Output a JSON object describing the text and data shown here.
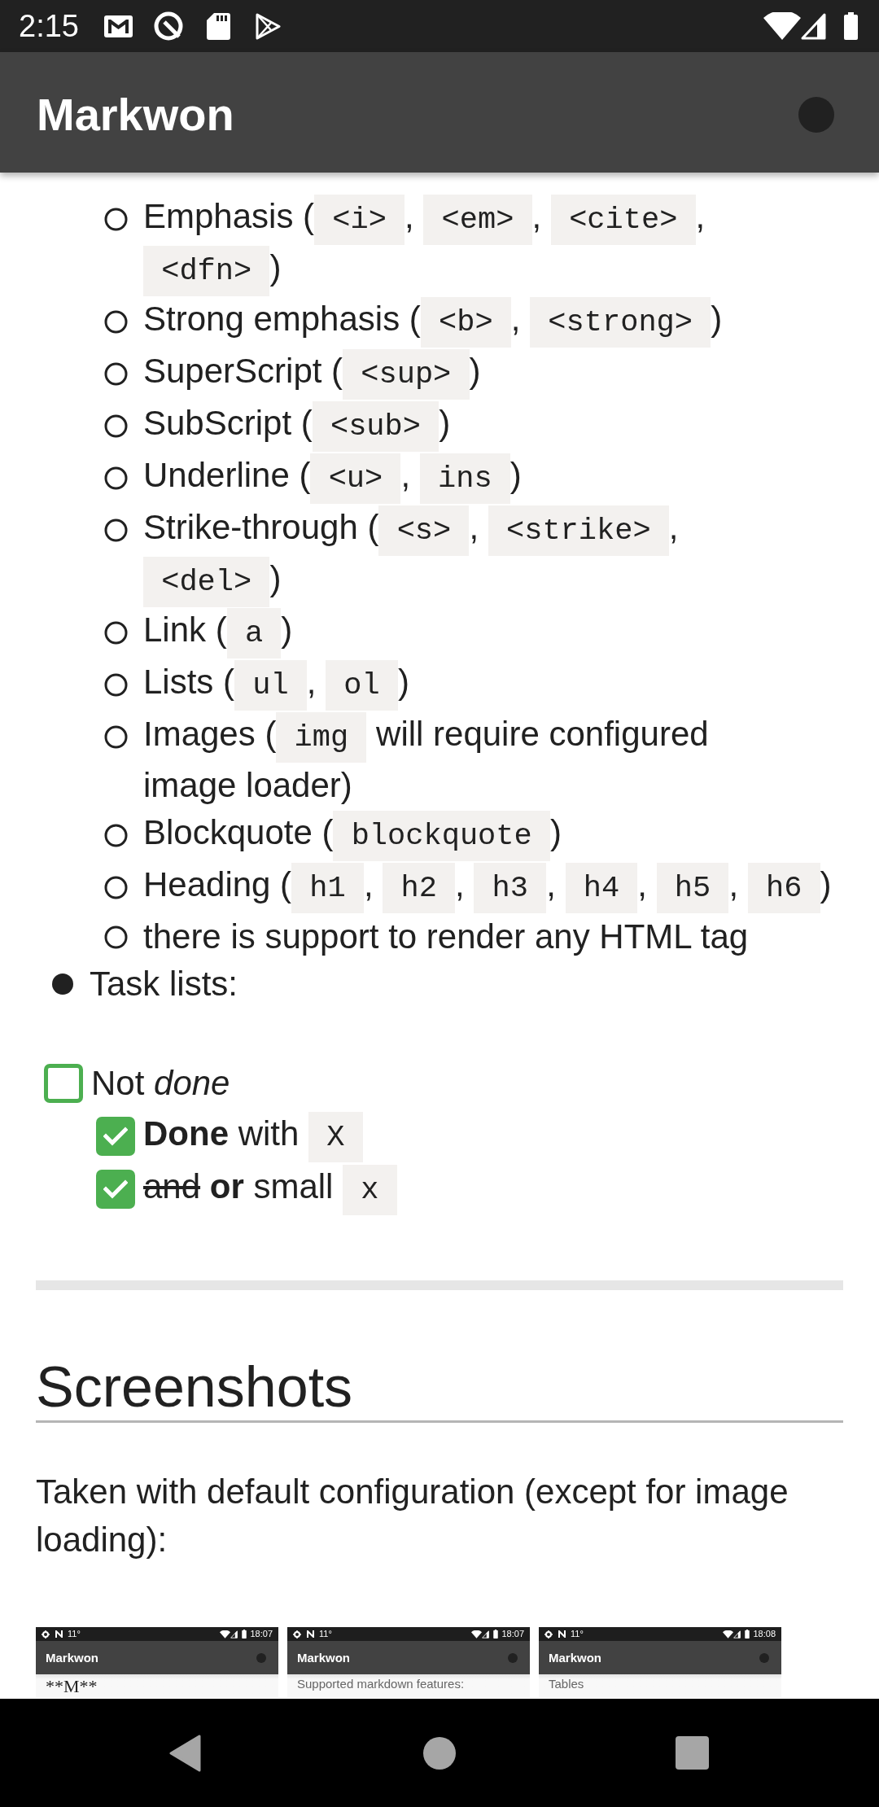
{
  "status_bar": {
    "time": "2:15"
  },
  "app_bar": {
    "title": "Markwon"
  },
  "list": [
    {
      "children": [
        {
          "lines": [
            [
              {
                "kind": "text",
                "text": "Emphasis ("
              },
              {
                "kind": "code",
                "text": "<i>"
              },
              {
                "kind": "text",
                "text": ", "
              },
              {
                "kind": "code",
                "text": "<em>"
              },
              {
                "kind": "text",
                "text": ", "
              },
              {
                "kind": "code",
                "text": "<cite>"
              },
              {
                "kind": "text",
                "text": ","
              }
            ],
            [
              {
                "kind": "code",
                "text": "<dfn>"
              },
              {
                "kind": "text",
                "text": ")"
              }
            ]
          ]
        },
        {
          "lines": [
            [
              {
                "kind": "text",
                "text": "Strong emphasis ("
              },
              {
                "kind": "code",
                "text": "<b>"
              },
              {
                "kind": "text",
                "text": ", "
              },
              {
                "kind": "code",
                "text": "<strong>"
              },
              {
                "kind": "text",
                "text": ")"
              }
            ]
          ]
        },
        {
          "lines": [
            [
              {
                "kind": "text",
                "text": "SuperScript ("
              },
              {
                "kind": "code",
                "text": "<sup>"
              },
              {
                "kind": "text",
                "text": ")"
              }
            ]
          ]
        },
        {
          "lines": [
            [
              {
                "kind": "text",
                "text": "SubScript ("
              },
              {
                "kind": "code",
                "text": "<sub>"
              },
              {
                "kind": "text",
                "text": ")"
              }
            ]
          ]
        },
        {
          "lines": [
            [
              {
                "kind": "text",
                "text": "Underline ("
              },
              {
                "kind": "code",
                "text": "<u>"
              },
              {
                "kind": "text",
                "text": ", "
              },
              {
                "kind": "code",
                "text": "ins"
              },
              {
                "kind": "text",
                "text": ")"
              }
            ]
          ]
        },
        {
          "lines": [
            [
              {
                "kind": "text",
                "text": "Strike-through ("
              },
              {
                "kind": "code",
                "text": "<s>"
              },
              {
                "kind": "text",
                "text": ", "
              },
              {
                "kind": "code",
                "text": "<strike>"
              },
              {
                "kind": "text",
                "text": ","
              }
            ],
            [
              {
                "kind": "code",
                "text": "<del>"
              },
              {
                "kind": "text",
                "text": ")"
              }
            ]
          ]
        },
        {
          "lines": [
            [
              {
                "kind": "text",
                "text": "Link ("
              },
              {
                "kind": "code",
                "text": "a"
              },
              {
                "kind": "text",
                "text": ")"
              }
            ]
          ]
        },
        {
          "lines": [
            [
              {
                "kind": "text",
                "text": "Lists ("
              },
              {
                "kind": "code",
                "text": "ul"
              },
              {
                "kind": "text",
                "text": ", "
              },
              {
                "kind": "code",
                "text": "ol"
              },
              {
                "kind": "text",
                "text": ")"
              }
            ]
          ]
        },
        {
          "lines": [
            [
              {
                "kind": "text",
                "text": "Images ("
              },
              {
                "kind": "code",
                "text": "img"
              },
              {
                "kind": "text",
                "text": " will require configured"
              }
            ],
            [
              {
                "kind": "text",
                "text": "image loader)"
              }
            ]
          ]
        },
        {
          "lines": [
            [
              {
                "kind": "text",
                "text": "Blockquote ("
              },
              {
                "kind": "code",
                "text": "blockquote"
              },
              {
                "kind": "text",
                "text": ")"
              }
            ]
          ]
        },
        {
          "lines": [
            [
              {
                "kind": "text",
                "text": "Heading ("
              },
              {
                "kind": "code",
                "text": "h1"
              },
              {
                "kind": "text",
                "text": ", "
              },
              {
                "kind": "code",
                "text": "h2"
              },
              {
                "kind": "text",
                "text": ", "
              },
              {
                "kind": "code",
                "text": "h3"
              },
              {
                "kind": "text",
                "text": ", "
              },
              {
                "kind": "code",
                "text": "h4"
              },
              {
                "kind": "text",
                "text": ", "
              },
              {
                "kind": "code",
                "text": "h5"
              },
              {
                "kind": "text",
                "text": ", "
              },
              {
                "kind": "code",
                "text": "h6"
              },
              {
                "kind": "text",
                "text": ")"
              }
            ]
          ]
        },
        {
          "lines": [
            [
              {
                "kind": "text",
                "text": "there is support to render any HTML tag"
              }
            ]
          ]
        }
      ]
    },
    {
      "lines": [
        [
          {
            "kind": "text",
            "text": "Task lists:"
          }
        ]
      ]
    }
  ],
  "task_list": [
    {
      "checked": false,
      "parts": [
        {
          "kind": "text",
          "text": "Not "
        },
        {
          "kind": "italic",
          "text": "done"
        }
      ],
      "children": [
        {
          "checked": true,
          "parts": [
            {
              "kind": "bold",
              "text": "Done"
            },
            {
              "kind": "text",
              "text": " with "
            },
            {
              "kind": "code",
              "text": "X"
            }
          ]
        },
        {
          "checked": true,
          "parts": [
            {
              "kind": "strike",
              "text": "and"
            },
            {
              "kind": "bold",
              "text": " or"
            },
            {
              "kind": "text",
              "text": " small "
            },
            {
              "kind": "code",
              "text": "x"
            }
          ]
        }
      ]
    }
  ],
  "heading": "Screenshots",
  "paragraph": "Taken with default configuration (except for image loading):",
  "screenshots": [
    {
      "temperature": "11°",
      "time": "18:07",
      "title": "Markwon",
      "content": {
        "kind": "display",
        "text": "**M**"
      }
    },
    {
      "temperature": "11°",
      "time": "18:07",
      "title": "Markwon",
      "content": {
        "kind": "body",
        "text": "Supported markdown features:"
      }
    },
    {
      "temperature": "11°",
      "time": "18:08",
      "title": "Markwon",
      "content": {
        "kind": "body",
        "text": "Tables"
      }
    }
  ]
}
